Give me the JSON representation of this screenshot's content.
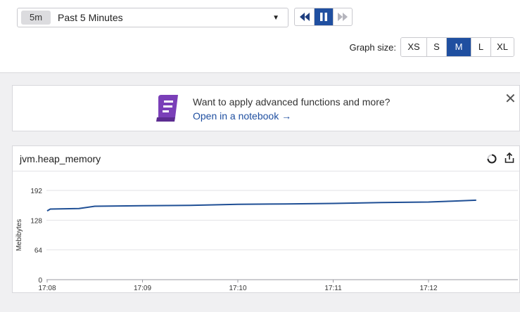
{
  "timepicker": {
    "badge": "5m",
    "label": "Past 5 Minutes"
  },
  "graph_size": {
    "label": "Graph size:",
    "options": [
      "XS",
      "S",
      "M",
      "L",
      "XL"
    ],
    "selected": "M"
  },
  "banner": {
    "text": "Want to apply advanced functions and more?",
    "link": "Open in a notebook →"
  },
  "panel": {
    "title": "jvm.heap_memory"
  },
  "colors": {
    "accent": "#1f4fa0",
    "notebook_icon": "#7a3fb8",
    "line": "#1f4f95"
  },
  "chart_data": {
    "type": "line",
    "title": "jvm.heap_memory",
    "xlabel": "",
    "ylabel": "Mebibytes",
    "ylim": [
      0,
      200
    ],
    "yticks": [
      0,
      64,
      128,
      192
    ],
    "xticks": [
      "17:08",
      "17:09",
      "17:10",
      "17:11",
      "17:12"
    ],
    "grid": true,
    "series": [
      {
        "values": [
          {
            "x": "17:08:00",
            "y": 148
          },
          {
            "x": "17:08:02",
            "y": 152
          },
          {
            "x": "17:08:20",
            "y": 153
          },
          {
            "x": "17:08:30",
            "y": 158
          },
          {
            "x": "17:09:00",
            "y": 159
          },
          {
            "x": "17:09:30",
            "y": 160
          },
          {
            "x": "17:10:00",
            "y": 162
          },
          {
            "x": "17:10:30",
            "y": 163
          },
          {
            "x": "17:11:00",
            "y": 164
          },
          {
            "x": "17:11:30",
            "y": 166
          },
          {
            "x": "17:12:00",
            "y": 167
          },
          {
            "x": "17:12:15",
            "y": 169
          },
          {
            "x": "17:12:30",
            "y": 171
          }
        ]
      }
    ]
  }
}
